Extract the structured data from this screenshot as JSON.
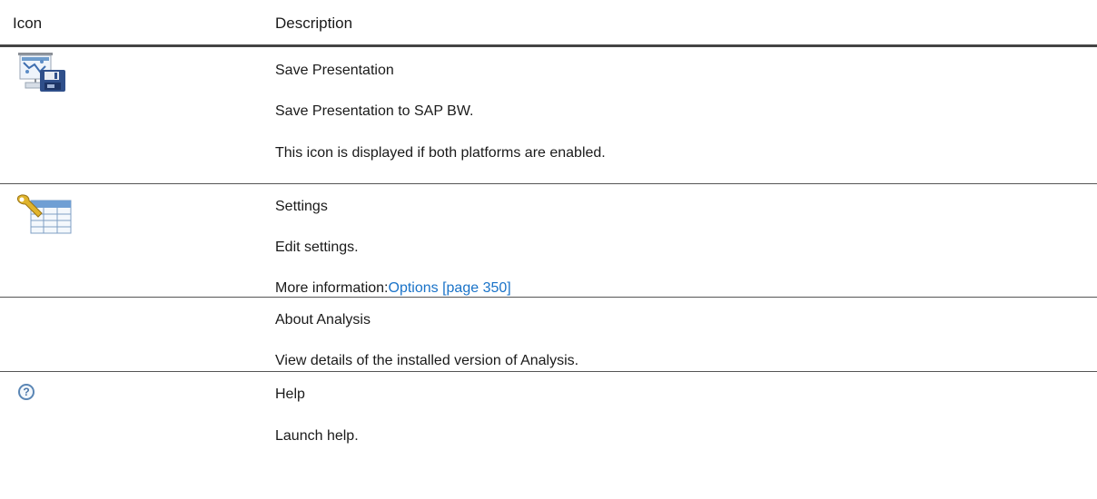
{
  "header": {
    "icon_col": "Icon",
    "description_col": "Description"
  },
  "rows": [
    {
      "icon": "save-presentation-icon",
      "title": "Save Presentation",
      "line2": "Save Presentation to SAP BW.",
      "line3": "This icon is displayed if both platforms are enabled."
    },
    {
      "icon": "settings-wrench-table-icon",
      "title": "Settings",
      "line2": "Edit settings.",
      "line3_prefix": "More information:",
      "line3_link": "Options [page 350]"
    },
    {
      "icon": "",
      "title": "About Analysis",
      "line2": "View details of the installed version of Analysis."
    },
    {
      "icon": "help-icon",
      "icon_glyph": "?",
      "title": "Help",
      "line2": "Launch help."
    }
  ],
  "colors": {
    "link": "#1a73c8",
    "header_rule": "#444444"
  }
}
